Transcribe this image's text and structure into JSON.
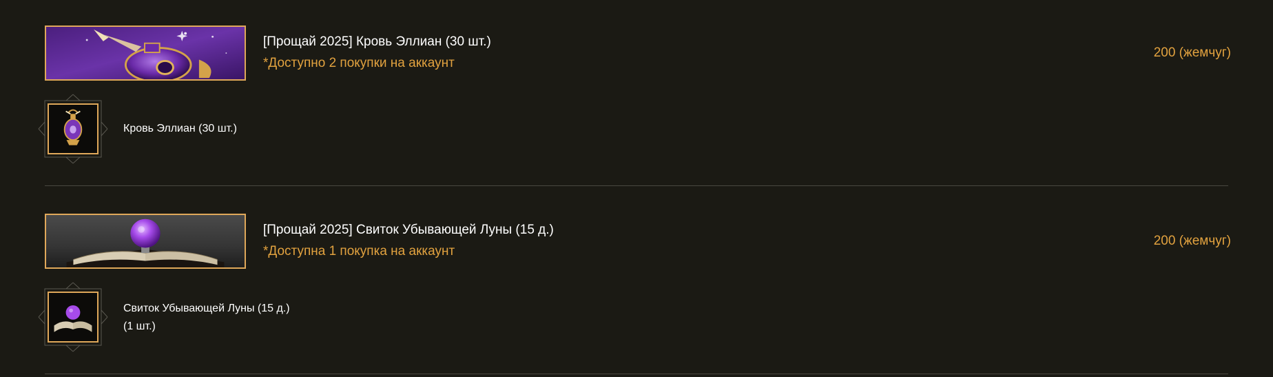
{
  "products": [
    {
      "title": "[Прощай 2025] Кровь Эллиан (30 шт.)",
      "limit": "*Доступно 2 покупки на аккаунт",
      "price": "200 (жемчуг)",
      "banner_icon": "purple-potion-vial-icon",
      "item": {
        "icon": "potion-vial-icon",
        "name_line1": "Кровь Эллиан (30 шт.)",
        "name_line2": ""
      }
    },
    {
      "title": "[Прощай 2025] Свиток Убывающей Луны (15 д.)",
      "limit": "*Доступна 1 покупка на аккаунт",
      "price": "200 (жемчуг)",
      "banner_icon": "crystal-orb-book-icon",
      "item": {
        "icon": "orb-book-icon",
        "name_line1": "Свиток Убывающей Луны (15 д.)",
        "name_line2": "(1 шт.)"
      }
    }
  ],
  "colors": {
    "background": "#1b1a14",
    "accent_gold": "#e2a23f",
    "frame_gold": "#e0a85a",
    "divider": "#4a4840"
  }
}
